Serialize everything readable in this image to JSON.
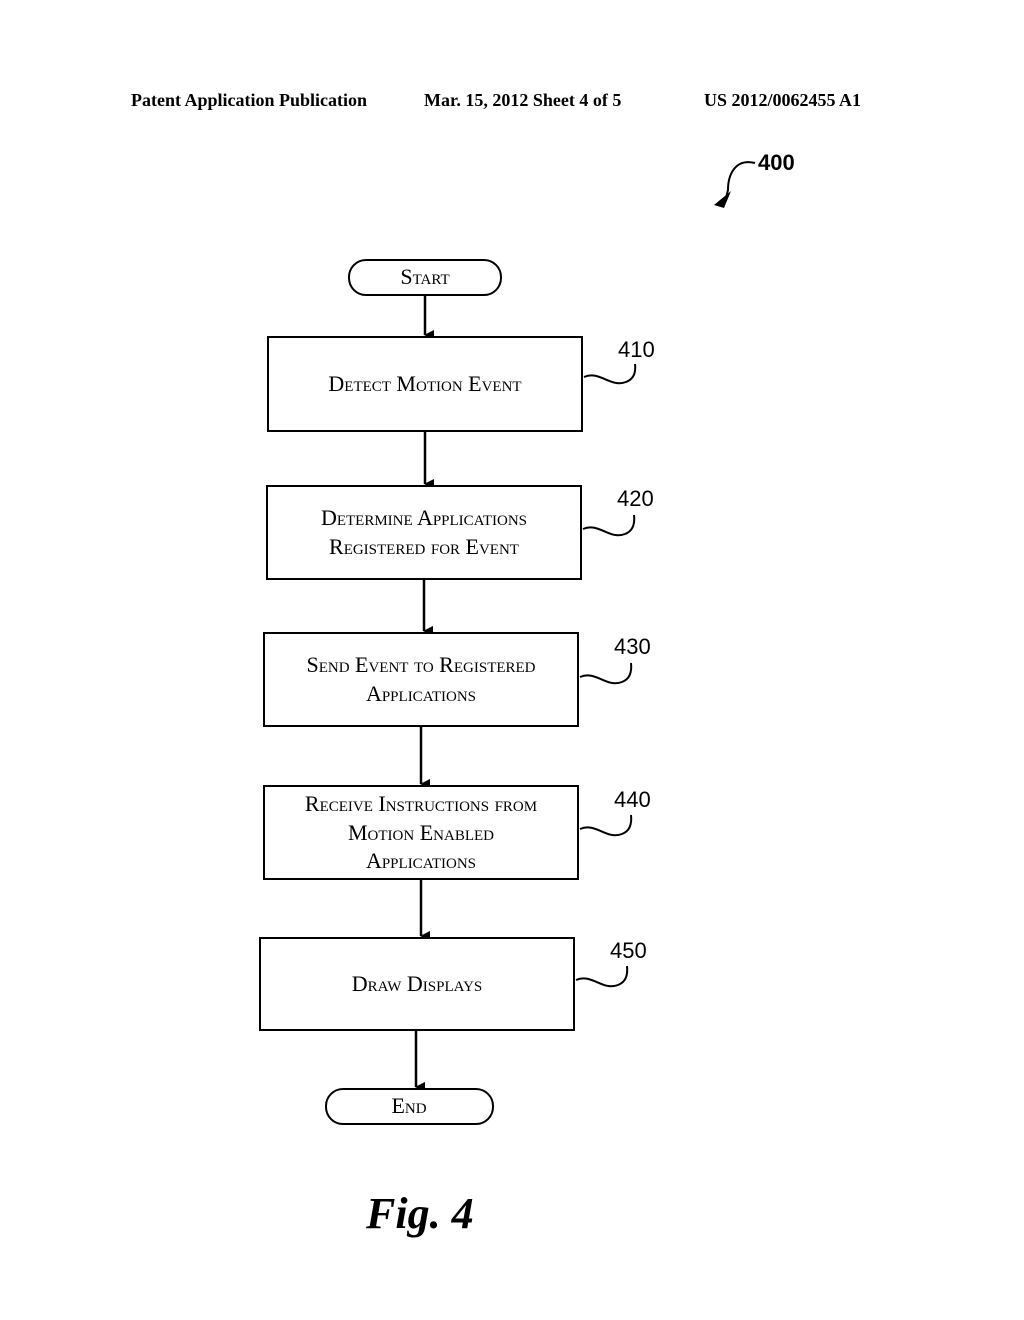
{
  "header": {
    "left": "Patent Application Publication",
    "center": "Mar. 15, 2012  Sheet 4 of 5",
    "right": "US 2012/0062455 A1"
  },
  "figure_ref": "400",
  "flowchart": {
    "start": "Start",
    "end": "End",
    "steps": [
      {
        "ref": "410",
        "lines": [
          "Detect Motion Event"
        ]
      },
      {
        "ref": "420",
        "lines": [
          "Determine Applications",
          "Registered for Event"
        ]
      },
      {
        "ref": "430",
        "lines": [
          "Send Event to Registered",
          "Applications"
        ]
      },
      {
        "ref": "440",
        "lines": [
          "Receive Instructions from",
          "Motion Enabled",
          "Applications"
        ]
      },
      {
        "ref": "450",
        "lines": [
          "Draw Displays"
        ]
      }
    ]
  },
  "caption": "Fig. 4"
}
